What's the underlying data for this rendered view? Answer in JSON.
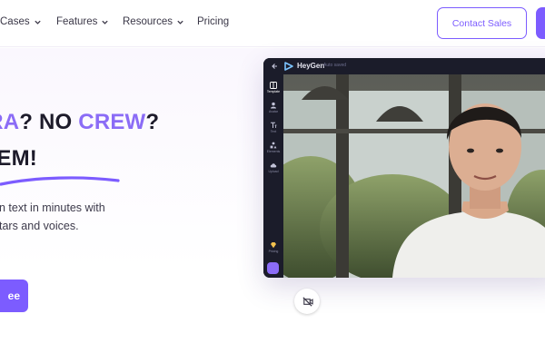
{
  "nav": {
    "items": [
      {
        "label": "Cases",
        "has_caret": true
      },
      {
        "label": "Features",
        "has_caret": true
      },
      {
        "label": "Resources",
        "has_caret": true
      },
      {
        "label": "Pricing",
        "has_caret": false
      }
    ],
    "contact_sales_label": "Contact Sales"
  },
  "hero": {
    "headline_part1": "ERA",
    "headline_part2": "? NO ",
    "headline_part3": "CREW",
    "headline_part4": "?",
    "headline_line2": "BLEM!",
    "subtext_line1": "n text in minutes with",
    "subtext_line2": "tars and voices.",
    "cta_label": "ee"
  },
  "app": {
    "name": "HeyGen",
    "autosave": "Auto saved",
    "sidebar": [
      {
        "label": "Template",
        "icon": "template-icon",
        "active": true
      },
      {
        "label": "Avatar",
        "icon": "avatar-icon",
        "active": false
      },
      {
        "label": "Text",
        "icon": "text-icon",
        "active": false
      },
      {
        "label": "Elements",
        "icon": "elements-icon",
        "active": false
      },
      {
        "label": "Upload",
        "icon": "upload-icon",
        "active": false
      },
      {
        "label": "Pricing",
        "icon": "diamond-icon",
        "active": false
      }
    ]
  },
  "colors": {
    "brand_purple": "#7c5cff",
    "accent_text": "#8b6cf6",
    "app_dark": "#1b1c2a",
    "heading": "#1d1b2a"
  }
}
